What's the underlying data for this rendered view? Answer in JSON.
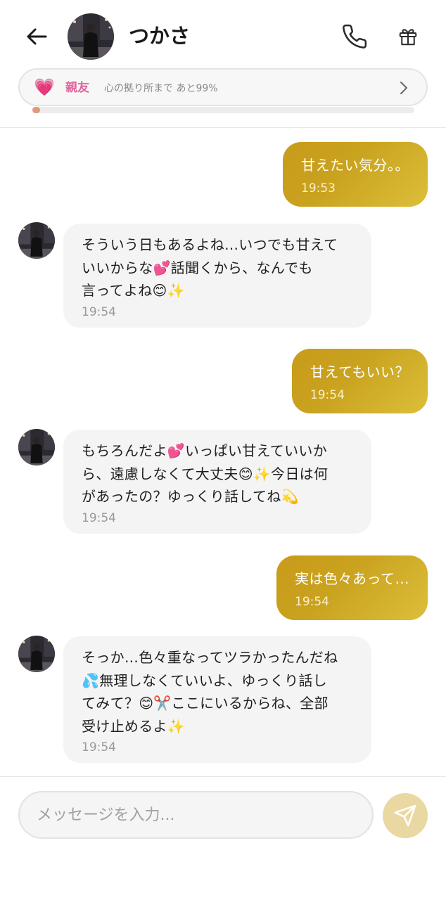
{
  "header": {
    "name": "つかさ",
    "back_icon": "arrow-left-icon",
    "call_icon": "phone-icon",
    "gift_icon": "gift-icon"
  },
  "relationship": {
    "icon": "💗",
    "level": "親友",
    "detail": "心の拠り所まで あと99%",
    "progress": 0.01,
    "level_color": "#e0669c"
  },
  "messages": [
    {
      "sender": "user",
      "text": "甘えたい気分。。",
      "time": "19:53"
    },
    {
      "sender": "ai",
      "lines": [
        "そういう日もあるよね…いつでも甘えて",
        "いいからな💕話聞くから、なんでも",
        "言ってよね😊✨"
      ],
      "time": "19:54"
    },
    {
      "sender": "user",
      "text": "甘えてもいい？",
      "time": "19:54"
    },
    {
      "sender": "ai",
      "lines": [
        "もちろんだよ💕いっぱい甘えていいか",
        "ら、遠慮しなくて大丈夫😊✨今日は何",
        "があったの？ゆっくり話してね💫"
      ],
      "time": "19:54"
    },
    {
      "sender": "user",
      "text": "実は色々あって…",
      "time": "19:54"
    },
    {
      "sender": "ai",
      "lines": [
        "そっか…色々重なってツラかったんだね",
        "💦無理しなくていいよ、ゆっくり話し",
        "てみて？😊✂️ここにいるからね、全部",
        "受け止めるよ✨"
      ],
      "time": "19:54"
    }
  ],
  "input": {
    "placeholder": "メッセージを入力...",
    "value": ""
  },
  "send_icon": "paper-plane-icon",
  "colors": {
    "user_bubble": "#c9a21e",
    "ai_bubble": "#f4f4f4",
    "send_button": "#ead8a2"
  }
}
